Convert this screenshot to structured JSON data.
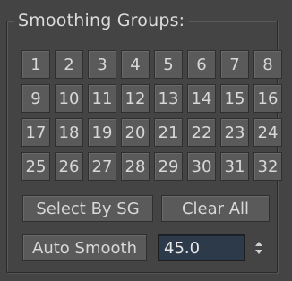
{
  "group": {
    "title": "Smoothing Groups:"
  },
  "smoothing_groups": [
    "1",
    "2",
    "3",
    "4",
    "5",
    "6",
    "7",
    "8",
    "9",
    "10",
    "11",
    "12",
    "13",
    "14",
    "15",
    "16",
    "17",
    "18",
    "19",
    "20",
    "21",
    "22",
    "23",
    "24",
    "25",
    "26",
    "27",
    "28",
    "29",
    "30",
    "31",
    "32"
  ],
  "buttons": {
    "select_by_sg": "Select By SG",
    "clear_all": "Clear All",
    "auto_smooth": "Auto Smooth"
  },
  "auto_smooth_threshold": {
    "value": "45.0"
  },
  "icons": {
    "spinner": "spinner-arrows-icon"
  },
  "colors": {
    "panel_bg": "#444444",
    "button_bg": "#5a5a5a",
    "input_bg": "#2c3a4a",
    "text": "#dcdcdc"
  }
}
